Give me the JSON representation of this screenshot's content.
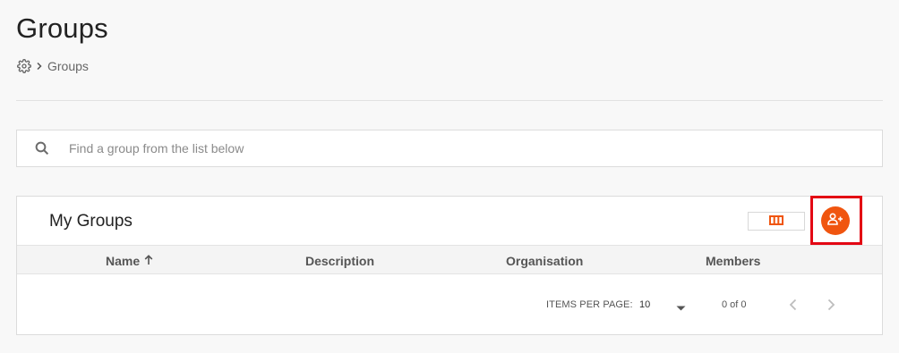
{
  "page": {
    "title": "Groups"
  },
  "breadcrumb": {
    "icon": "gear-icon",
    "separator_icon": "chevron-right-icon",
    "current": "Groups"
  },
  "search": {
    "placeholder": "Find a group from the list below",
    "value": ""
  },
  "card": {
    "title": "My Groups",
    "columns_button_icon": "columns-icon",
    "add_button_icon": "add-group-icon"
  },
  "table": {
    "columns": [
      {
        "label": "Name",
        "sort": "ascending",
        "sort_icon": "arrow-up-icon"
      },
      {
        "label": "Description"
      },
      {
        "label": "Organisation"
      },
      {
        "label": "Members"
      }
    ],
    "rows": []
  },
  "paginator": {
    "items_per_page_label": "ITEMS PER PAGE:",
    "page_size": "10",
    "range": "0 of 0"
  },
  "colors": {
    "accent": "#f0550f",
    "highlight": "#e30613",
    "background": "#f8f8f8"
  }
}
